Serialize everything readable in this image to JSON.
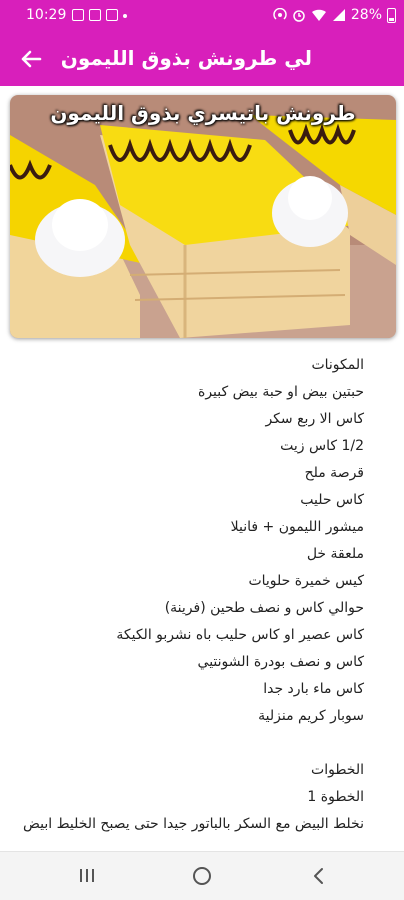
{
  "status_bar": {
    "time": "10:29",
    "battery": "28%"
  },
  "app_bar": {
    "title": "لي طرونش بذوق الليمون"
  },
  "hero_image": {
    "caption": "طرونش باتيسري بذوق الليمون"
  },
  "content": {
    "ingredients_title": "المكونات",
    "ingredients": [
      "حبتين بيض او حبة بيض كبيرة",
      "كاس الا ربع سكر",
      "1/2 كاس زيت",
      "قرصة ملح",
      "كاس حليب",
      "ميشور الليمون + فانيلا",
      "ملعقة خل",
      "كيس خميرة حلويات",
      "حوالي كاس و نصف طحين (فرينة)",
      "كاس عصير او كاس حليب باه نشربو الكيكة",
      "كاس و نصف بودرة الشونتيي",
      "كاس ماء بارد جدا",
      "سوبار كريم منزلية"
    ],
    "steps_title": "الخطوات",
    "step_label": "الخطوة 1",
    "step_text": "نخلط البيض مع السكر بالباتور جيدا حتى يصبح الخليط ابيض"
  },
  "colors": {
    "primary": "#d81fbb"
  }
}
